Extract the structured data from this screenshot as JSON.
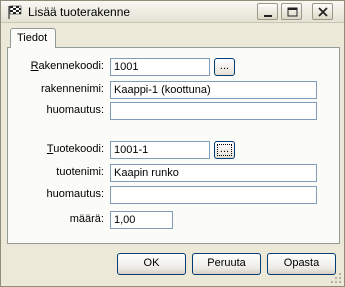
{
  "window": {
    "title": "Lisää tuoterakenne",
    "icon": "checkered-flag-icon"
  },
  "tabs": [
    {
      "label": "Tiedot",
      "selected": true
    }
  ],
  "structure": {
    "code_label_prefix": "R",
    "code_label_rest": "akennekoodi:",
    "code_value": "1001",
    "browse_label": "...",
    "name_label": "rakennenimi:",
    "name_value": "Kaappi-1 (koottuna)",
    "note_label": "huomautus:",
    "note_value": ""
  },
  "product": {
    "code_label_prefix": "T",
    "code_label_rest": "uotekoodi:",
    "code_value": "1001-1",
    "browse_label": "...",
    "name_label": "tuotenimi:",
    "name_value": "Kaapin runko",
    "note_label": "huomautus:",
    "note_value": "",
    "quantity_label": "määrä:",
    "quantity_value": "1,00"
  },
  "buttons": {
    "ok": "OK",
    "cancel": "Peruuta",
    "help": "Opasta"
  }
}
